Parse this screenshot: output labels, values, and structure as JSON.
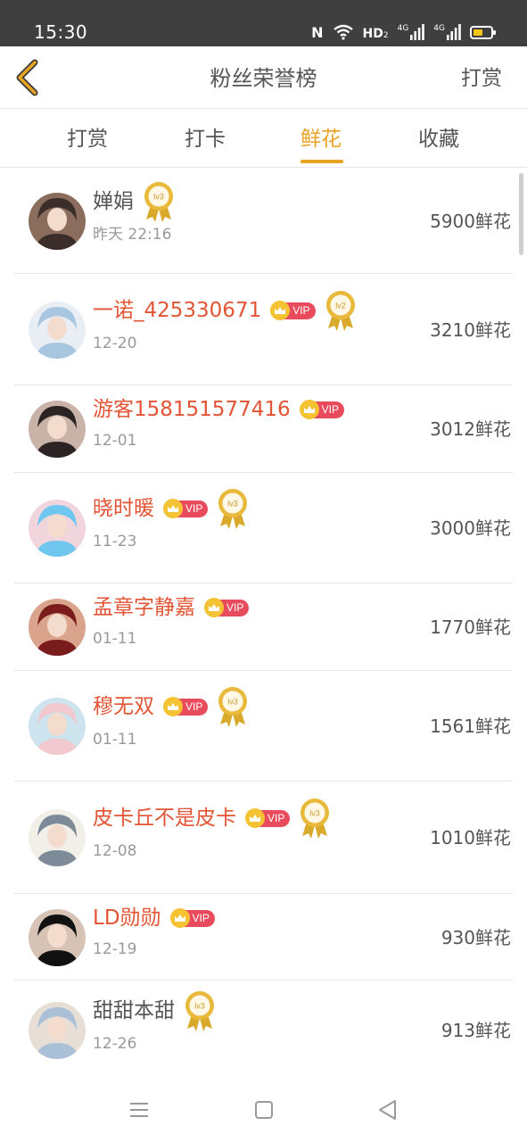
{
  "status_bar": {
    "time": "15:30",
    "nfc": "N",
    "hd": "HD",
    "hd_sub": "2",
    "net1": "4G",
    "net2": "4G",
    "battery_level": 0.55,
    "battery_color": "#f5c518"
  },
  "header": {
    "back_icon": "back-chevron-icon",
    "title": "粉丝荣誉榜",
    "right_action": "打赏",
    "back_color": "#e9a323"
  },
  "tabs": [
    {
      "label": "打赏",
      "active": false
    },
    {
      "label": "打卡",
      "active": false
    },
    {
      "label": "鲜花",
      "active": true
    },
    {
      "label": "收藏",
      "active": false
    }
  ],
  "accent_color": "#e9a323",
  "name_color_vip": "#e35434",
  "vip_label": "VIP",
  "fans": [
    {
      "name": "婵娟",
      "vip": false,
      "level": "lv3",
      "date": "昨天 22:16",
      "amount": "5900鲜花"
    },
    {
      "name": "一诺_425330671",
      "vip": true,
      "level": "lv2",
      "date": "12-20",
      "amount": "3210鲜花"
    },
    {
      "name": "游客158151577416",
      "vip": true,
      "level": null,
      "date": "12-01",
      "amount": "3012鲜花"
    },
    {
      "name": "晓时暖",
      "vip": true,
      "level": "lv3",
      "date": "11-23",
      "amount": "3000鲜花"
    },
    {
      "name": "孟章字静嘉",
      "vip": true,
      "level": null,
      "date": "01-11",
      "amount": "1770鲜花"
    },
    {
      "name": "穆无双",
      "vip": true,
      "level": "lv3",
      "date": "01-11",
      "amount": "1561鲜花"
    },
    {
      "name": "皮卡丘不是皮卡",
      "vip": true,
      "level": "lv3",
      "date": "12-08",
      "amount": "1010鲜花"
    },
    {
      "name": "LD勋勋",
      "vip": true,
      "level": null,
      "date": "12-19",
      "amount": "930鲜花"
    },
    {
      "name": "甜甜本甜",
      "vip": false,
      "level": "lv3",
      "date": "12-26",
      "amount": "913鲜花"
    }
  ],
  "navbar": {
    "menu_icon": "menu-icon",
    "home_icon": "home-square-icon",
    "back_icon": "back-triangle-icon"
  }
}
